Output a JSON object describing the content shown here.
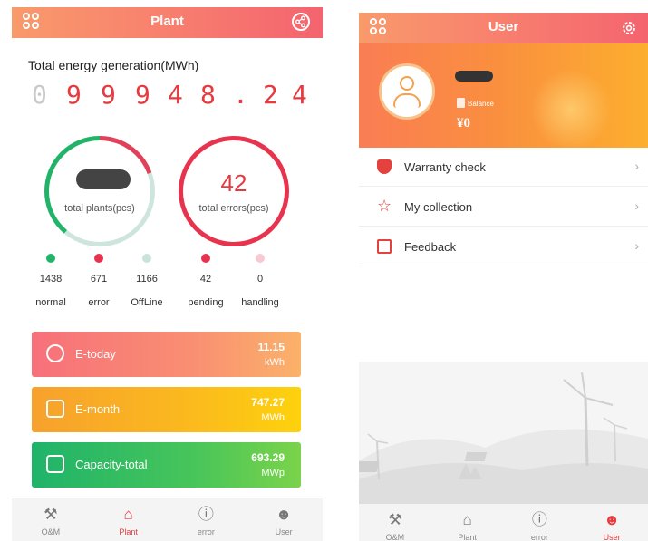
{
  "plant_screen": {
    "header": {
      "title": "Plant",
      "apps_icon": "apps-icon",
      "share_icon": "share-icon"
    },
    "energy": {
      "label": "Total energy generation(MWh)",
      "digits": [
        "0",
        "9",
        "9",
        "9",
        "4",
        "8",
        ".",
        "2",
        "4"
      ]
    },
    "plants_ring": {
      "caption": "total plants(pcs)"
    },
    "errors_ring": {
      "value": "42",
      "caption": "total errors(pcs)"
    },
    "stats": [
      {
        "count": "1438",
        "label": "normal",
        "color": "#21b468"
      },
      {
        "count": "671",
        "label": "error",
        "color": "#e8334f"
      },
      {
        "count": "1166",
        "label": "OffLine",
        "color": "#c8e3d8"
      },
      {
        "count": "42",
        "label": "pending",
        "color": "#e8334f"
      },
      {
        "count": "0",
        "label": "handling",
        "color": "#f7c9d3"
      }
    ],
    "cards": [
      {
        "name": "E-today",
        "value": "11.15",
        "unit": "kWh",
        "icon": "clock-icon"
      },
      {
        "name": "E-month",
        "value": "747.27",
        "unit": "MWh",
        "icon": "calendar-icon"
      },
      {
        "name": "Capacity-total",
        "value": "693.29",
        "unit": "MWp",
        "icon": "battery-icon"
      }
    ]
  },
  "user_screen": {
    "header": {
      "title": "User",
      "apps_icon": "apps-icon",
      "settings_icon": "gear-icon"
    },
    "profile": {
      "balance_label": "Balance",
      "balance_value": "¥0"
    },
    "menu": [
      {
        "label": "Warranty check",
        "icon": "shield-icon"
      },
      {
        "label": "My collection",
        "icon": "star-icon"
      },
      {
        "label": "Feedback",
        "icon": "feedback-icon"
      }
    ]
  },
  "tabs": [
    {
      "label": "O&M",
      "icon": "wrench-icon"
    },
    {
      "label": "Plant",
      "icon": "house-bolt-icon"
    },
    {
      "label": "error",
      "icon": "alert-icon"
    },
    {
      "label": "User",
      "icon": "person-icon"
    }
  ],
  "colors": {
    "accent": "#e63a3f",
    "header_from": "#f99a6b",
    "header_to": "#f4646f"
  }
}
